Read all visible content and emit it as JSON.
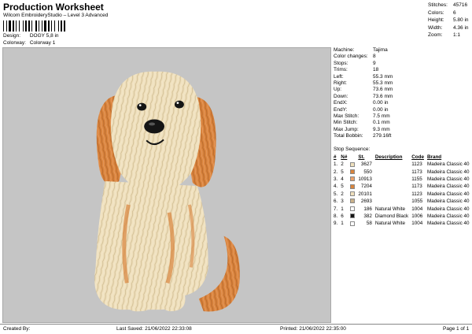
{
  "header": {
    "title": "Production Worksheet",
    "subtitle": "Wilcom EmbroideryStudio – Level 3 Advanced",
    "design_label": "Design:",
    "design_value": "DOGY 5,8 in",
    "colorway_label": "Colorway:",
    "colorway_value": "Colorway 1"
  },
  "stats": [
    {
      "label": "Stitches:",
      "value": "45716"
    },
    {
      "label": "Colors:",
      "value": "6"
    },
    {
      "label": "Height:",
      "value": "5.80 in"
    },
    {
      "label": "Width:",
      "value": "4.36 in"
    },
    {
      "label": "Zoom:",
      "value": "1:1"
    }
  ],
  "machine_info": [
    {
      "label": "Machine:",
      "value": "Tajima"
    },
    {
      "label": "Color changes:",
      "value": "8"
    },
    {
      "label": "Stops:",
      "value": "9"
    },
    {
      "label": "Trims:",
      "value": "18"
    },
    {
      "label": "Left:",
      "value": "55.3 mm"
    },
    {
      "label": "Right:",
      "value": "55.3 mm"
    },
    {
      "label": "Up:",
      "value": "73.6 mm"
    },
    {
      "label": "Down:",
      "value": "73.6 mm"
    },
    {
      "label": "EndX:",
      "value": "0.00 in"
    },
    {
      "label": "EndY:",
      "value": "0.00 in"
    },
    {
      "label": "Max Stitch:",
      "value": "7.5 mm"
    },
    {
      "label": "Min Stitch:",
      "value": "0.1 mm"
    },
    {
      "label": "Max Jump:",
      "value": "9.3 mm"
    },
    {
      "label": "Total Bobbin:",
      "value": "279.16ft"
    }
  ],
  "stop_sequence": {
    "title": "Stop Sequence:",
    "columns": [
      "#",
      "N#",
      "St.",
      "Description",
      "Code",
      "Brand"
    ],
    "rows": [
      {
        "num": "1.",
        "n": "2",
        "color": "#efe0bd",
        "st": "3627",
        "desc": "",
        "code": "1123",
        "brand": "Madeira Classic 40"
      },
      {
        "num": "2.",
        "n": "5",
        "color": "#d9843d",
        "st": "550",
        "desc": "",
        "code": "1173",
        "brand": "Madeira Classic 40"
      },
      {
        "num": "3.",
        "n": "4",
        "color": "#eba16a",
        "st": "10913",
        "desc": "",
        "code": "1155",
        "brand": "Madeira Classic 40"
      },
      {
        "num": "4.",
        "n": "5",
        "color": "#d9843d",
        "st": "7204",
        "desc": "",
        "code": "1173",
        "brand": "Madeira Classic 40"
      },
      {
        "num": "5.",
        "n": "2",
        "color": "#efe0bd",
        "st": "20101",
        "desc": "",
        "code": "1123",
        "brand": "Madeira Classic 40"
      },
      {
        "num": "6.",
        "n": "3",
        "color": "#c9b18a",
        "st": "2693",
        "desc": "",
        "code": "1055",
        "brand": "Madeira Classic 40"
      },
      {
        "num": "7.",
        "n": "1",
        "color": "#ffffff",
        "st": "186",
        "desc": "Natural White",
        "code": "1004",
        "brand": "Madeira Classic 40"
      },
      {
        "num": "8.",
        "n": "6",
        "color": "#151515",
        "st": "382",
        "desc": "Diamond Black",
        "code": "1006",
        "brand": "Madeira Classic 40"
      },
      {
        "num": "9.",
        "n": "1",
        "color": "#ffffff",
        "st": "58",
        "desc": "Natural White",
        "code": "1004",
        "brand": "Madeira Classic 40"
      }
    ]
  },
  "footer": {
    "created_by": "Created By:",
    "last_saved": "Last Saved: 21/06/2022 22:33:08",
    "printed": "Printed: 21/06/2022 22:35:00",
    "page": "Page 1 of 1"
  },
  "colors": {
    "canvas_bg": "#c5c5c5",
    "fur_light": "#efe0bd",
    "fur_orange": "#d9843d",
    "fur_tan": "#c9b18a",
    "eye_nose": "#151515"
  }
}
